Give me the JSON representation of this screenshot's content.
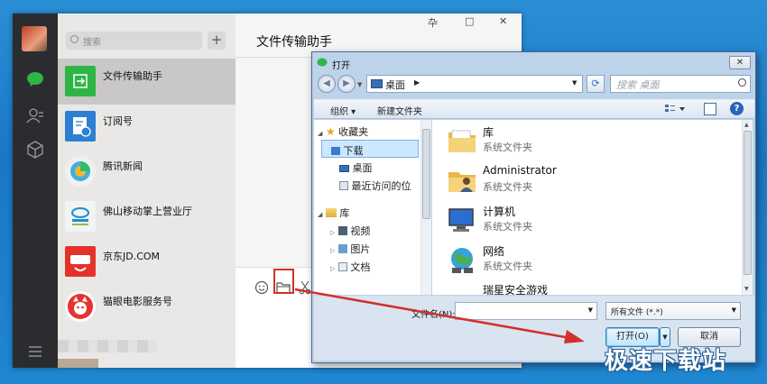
{
  "wechat": {
    "search_placeholder": "搜索",
    "add_button": "+",
    "chat_title": "文件传输助手",
    "window_controls": [
      "卆",
      "□",
      "✕"
    ],
    "contacts": [
      {
        "name": "文件传输助手",
        "selected": true,
        "color": "#2fb545"
      },
      {
        "name": "订阅号",
        "selected": false,
        "color": "#2d7fd3"
      },
      {
        "name": "腾讯新闻",
        "selected": false,
        "color": "#f0f0f0"
      },
      {
        "name": "佛山移动掌上营业厅",
        "selected": false,
        "color": "#f3f3f3"
      },
      {
        "name": "京东JD.COM",
        "selected": false,
        "color": "#e4322b"
      },
      {
        "name": "猫眼电影服务号",
        "selected": false,
        "color": "#e7322e"
      }
    ],
    "sidebar_icons": [
      "chat-icon",
      "contacts-icon",
      "favorites-icon",
      "menu-icon"
    ],
    "toolbar_icons": [
      "emoji-icon",
      "folder-icon",
      "scissors-icon"
    ]
  },
  "dialog": {
    "title": "打开",
    "close": "✕",
    "address": "桌面",
    "search_placeholder": "搜索 桌面",
    "toolbar": {
      "organize": "组织 ▾",
      "new_folder": "新建文件夹"
    },
    "nav_items": [
      {
        "label": "收藏夹",
        "type": "group"
      },
      {
        "label": "下载",
        "type": "item",
        "selected": true
      },
      {
        "label": "桌面",
        "type": "item"
      },
      {
        "label": "最近访问的位",
        "type": "item"
      },
      {
        "label": "库",
        "type": "group"
      },
      {
        "label": "视频",
        "type": "item"
      },
      {
        "label": "图片",
        "type": "item"
      },
      {
        "label": "文档",
        "type": "item"
      }
    ],
    "files": [
      {
        "name": "库",
        "desc": "系统文件夹",
        "icon": "library-folder-icon"
      },
      {
        "name": "Administrator",
        "desc": "系统文件夹",
        "icon": "user-folder-icon"
      },
      {
        "name": "计算机",
        "desc": "系统文件夹",
        "icon": "computer-icon"
      },
      {
        "name": "网络",
        "desc": "系统文件夹",
        "icon": "network-icon"
      },
      {
        "name": "瑞星安全游戏",
        "desc": "",
        "icon": "shortcut-icon"
      }
    ],
    "filename_label": "文件名(N):",
    "filename_value": "",
    "filetype": "所有文件 (*.*)",
    "open_button": "打开(O)",
    "cancel_button": "取消"
  },
  "watermark": "极速下载站",
  "colors": {
    "highlight": "#d0312b",
    "wechat_green": "#2fb545"
  }
}
